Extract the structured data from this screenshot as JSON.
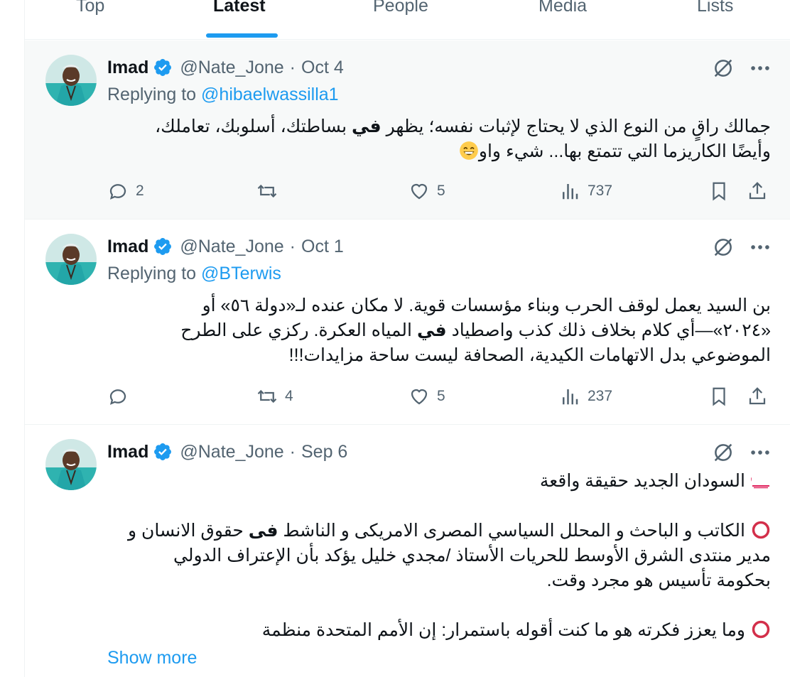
{
  "tabs": [
    {
      "label": "Top",
      "active": false
    },
    {
      "label": "Latest",
      "active": true
    },
    {
      "label": "People",
      "active": false
    },
    {
      "label": "Media",
      "active": false
    },
    {
      "label": "Lists",
      "active": false
    }
  ],
  "colors": {
    "accent": "#1d9bf0",
    "muted": "#536471",
    "text": "#0f1419",
    "hover_bg": "#f7f9f9",
    "circle_red": "#d32f4a"
  },
  "tweets": [
    {
      "name": "Imad",
      "handle": "@Nate_Jone",
      "separator": "·",
      "date": "Oct 4",
      "replying_prefix": "Replying to",
      "replying_to": "@hibaelwassilla1",
      "lines": [
        {
          "pre": "جمالك راقٍ من النوع الذي لا يحتاج لإثبات نفسه؛ يظهر ",
          "bold": "في",
          "post": " بساطتك، أسلوبك، تعاملك،"
        },
        {
          "pre": "وأيضًا الكاريزما التي تتمتع بها... شيء واو",
          "bold": "",
          "post": ""
        }
      ],
      "emoji": "grinning-face-emoji",
      "stats": {
        "replies": "2",
        "retweets": "",
        "likes": "5",
        "views": "737"
      }
    },
    {
      "name": "Imad",
      "handle": "@Nate_Jone",
      "separator": "·",
      "date": "Oct 1",
      "replying_prefix": "Replying to",
      "replying_to": "@BTerwis",
      "lines": [
        {
          "pre": "بن السيد يعمل لوقف الحرب وبناء مؤسسات قوية. لا مكان عنده لـ«دولة ٥٦» أو",
          "bold": "",
          "post": ""
        },
        {
          "pre": "«٢٠٢٤»—أي كلام بخلاف ذلك كذب واصطياد ",
          "bold": "في",
          "post": " المياه العكرة. ركزي على الطرح"
        },
        {
          "pre": "الموضوعي بدل الاتهامات الكيدية، الصحافة ليست ساحة مزايدات!!!",
          "bold": "",
          "post": ""
        }
      ],
      "stats": {
        "replies": "",
        "retweets": "4",
        "likes": "5",
        "views": "237"
      }
    },
    {
      "name": "Imad",
      "handle": "@Nate_Jone",
      "separator": "·",
      "date": "Sep 6",
      "lines": [
        {
          "pre": "السودان الجديد حقيقة واقعة",
          "bold": "",
          "post": ""
        },
        {
          "pre": "",
          "bold": "",
          "post": ""
        },
        {
          "pre": "الكاتب و الباحث و المحلل السياسي المصرى الامريكى و الناشط ",
          "bold": "فى",
          "post": " حقوق الانسان و"
        },
        {
          "pre": "مدير منتدى الشرق الأوسط للحريات الأستاذ /مجدي خليل يؤكد بأن الإعتراف الدولي",
          "bold": "",
          "post": ""
        },
        {
          "pre": "بحكومة تأسيس هو مجرد وقت.",
          "bold": "",
          "post": ""
        },
        {
          "pre": "",
          "bold": "",
          "post": ""
        },
        {
          "pre": "وما يعزز فكرته هو ما كنت أقوله باستمرار: إن الأمم المتحدة منظمة",
          "bold": "",
          "post": ""
        }
      ],
      "show_more": "Show more"
    }
  ]
}
